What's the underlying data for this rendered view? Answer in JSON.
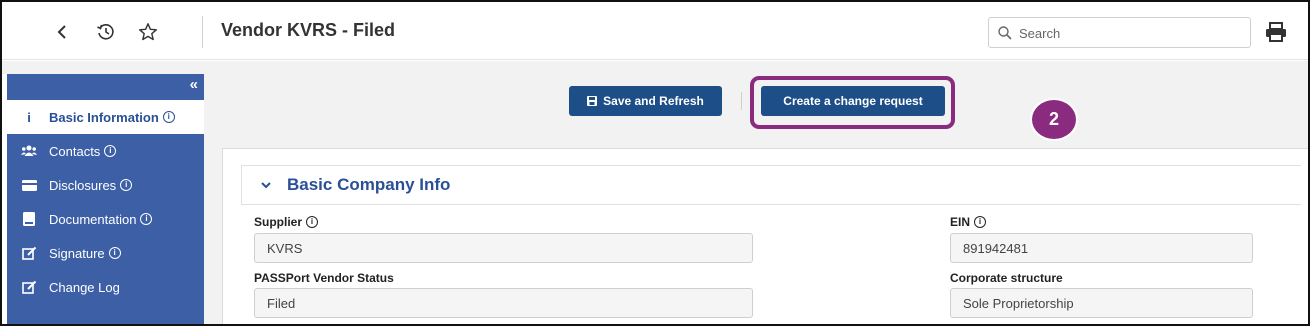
{
  "header": {
    "title": "Vendor KVRS - Filed",
    "search_placeholder": "Search"
  },
  "sidebar": {
    "collapse_label": "«",
    "items": [
      {
        "label": "Basic Information",
        "icon": "info-icon",
        "active": true,
        "info": true
      },
      {
        "label": "Contacts",
        "icon": "users-icon",
        "active": false,
        "info": true
      },
      {
        "label": "Disclosures",
        "icon": "card-icon",
        "active": false,
        "info": true
      },
      {
        "label": "Documentation",
        "icon": "book-icon",
        "active": false,
        "info": true
      },
      {
        "label": "Signature",
        "icon": "edit-icon",
        "active": false,
        "info": true
      },
      {
        "label": "Change Log",
        "icon": "edit-icon",
        "active": false,
        "info": false
      }
    ]
  },
  "toolbar": {
    "save_label": "Save and Refresh",
    "change_request_label": "Create a change request"
  },
  "callout": {
    "number": "2",
    "color": "#8b2b7f"
  },
  "section": {
    "title": "Basic Company Info"
  },
  "fields": {
    "supplier": {
      "label": "Supplier",
      "value": "KVRS"
    },
    "ein": {
      "label": "EIN",
      "value": "891942481"
    },
    "vendor_status": {
      "label": "PASSPort Vendor Status",
      "value": "Filed"
    },
    "corporate_structure": {
      "label": "Corporate structure",
      "value": "Sole Proprietorship"
    }
  },
  "colors": {
    "sidebar": "#3c5fa6",
    "primary_button": "#1e4e87",
    "accent_title": "#2a4f96"
  }
}
